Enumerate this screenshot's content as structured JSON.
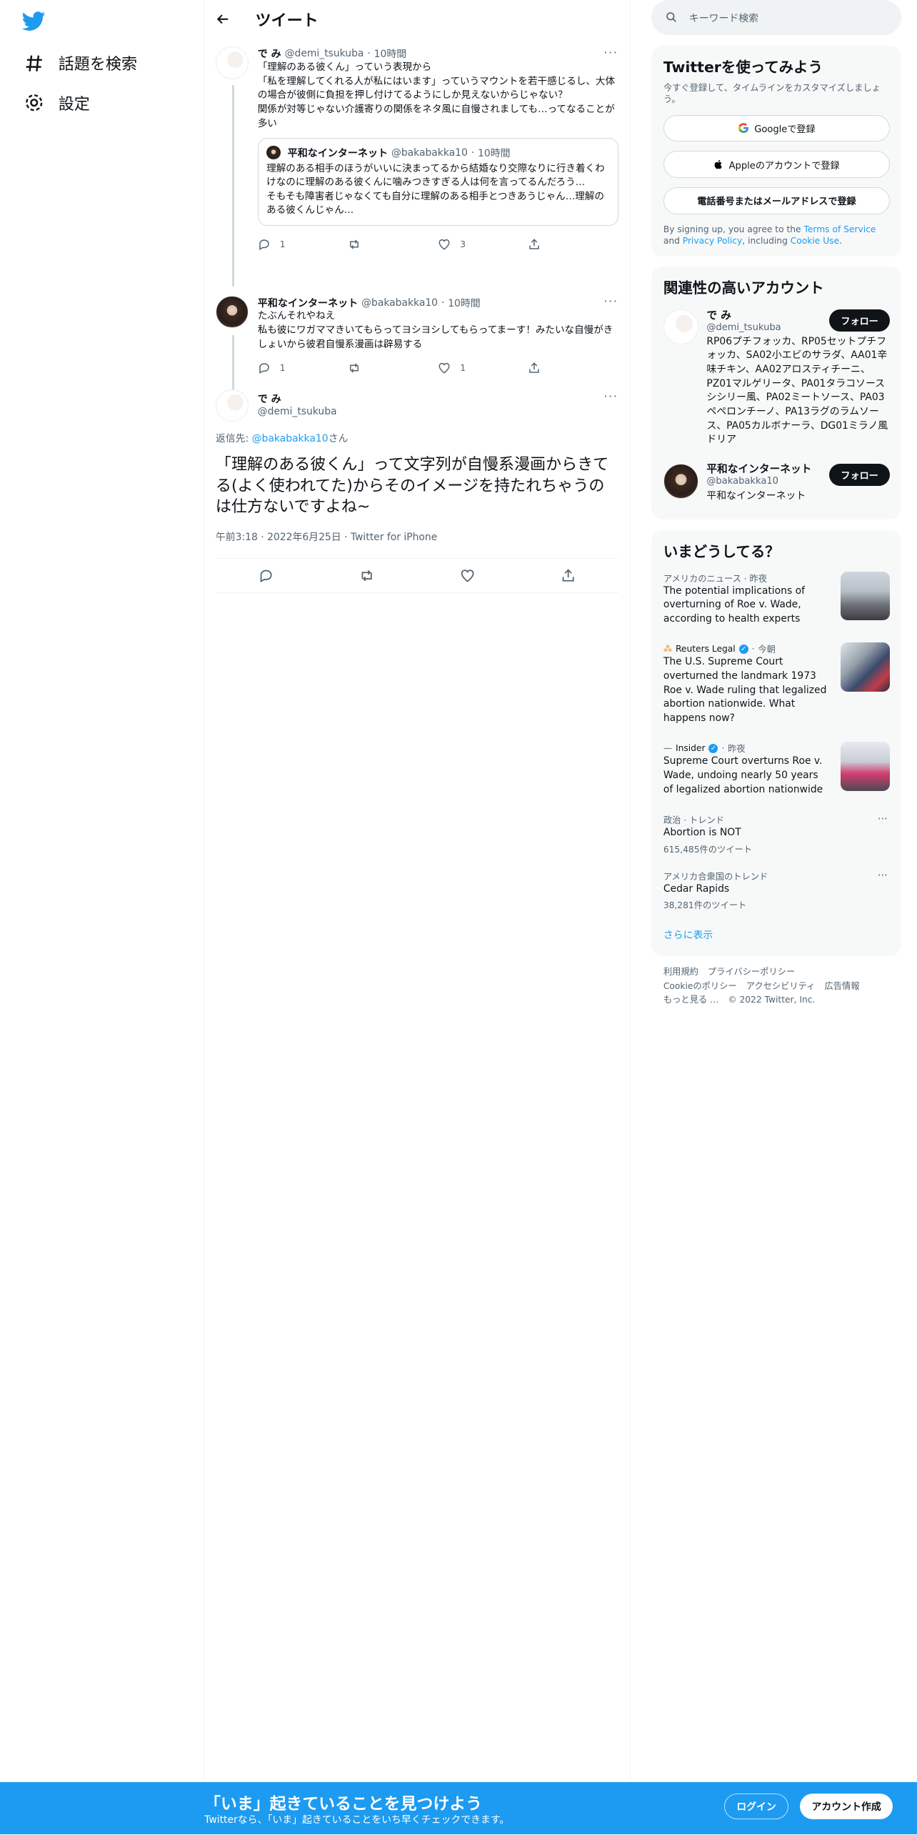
{
  "colors": {
    "accent": "#1d9bf0",
    "text": "#0f1419",
    "muted": "#536471"
  },
  "nav": {
    "explore": "話題を検索",
    "settings": "設定"
  },
  "header": {
    "title": "ツイート"
  },
  "tweet1": {
    "name": "で み",
    "handle": "@demi_tsukuba",
    "time": "10時間",
    "lines": [
      "「理解のある彼くん」っていう表現から",
      "「私を理解してくれる人が私にはいます」っていうマウントを若干感じるし、大体の場合が彼側に負担を押し付けてるようにしか見えないからじゃない？",
      "関係が対等じゃない介護寄りの関係をネタ風に自慢されましても…ってなることが多い"
    ],
    "quote": {
      "name": "平和なインターネット",
      "handle": "@bakabakka10",
      "time": "10時間",
      "lines": [
        "理解のある相手のほうがいいに決まってるから結婚なり交際なりに行き着くわけなのに理解のある彼くんに噛みつきすぎる人は何を言ってるんだろう…",
        "そもそも障害者じゃなくても自分に理解のある相手とつきあうじゃん…理解のある彼くんじゃん…"
      ]
    },
    "replies": "1",
    "retweets": "",
    "likes": "3"
  },
  "tweet2": {
    "name": "平和なインターネット",
    "handle": "@bakabakka10",
    "time": "10時間",
    "lines": [
      "たぶんそれやねえ",
      "私も彼にワガママきいてもらってヨシヨシしてもらってまーす！みたいな自慢がきしょいから彼君自慢系漫画は辟易する"
    ],
    "replies": "1",
    "retweets": "",
    "likes": "1"
  },
  "focus": {
    "name": "で み",
    "handle": "@demi_tsukuba",
    "reply_to_prefix": "返信先: ",
    "reply_to_handle": "@bakabakka10",
    "reply_to_suffix": "さん",
    "text": "「理解のある彼くん」って文字列が自慢系漫画からきてる(よく使われてた)からそのイメージを持たれちゃうのは仕方ないですよね~",
    "timestamp": "午前3:18 · 2022年6月25日 · Twitter for iPhone"
  },
  "search": {
    "placeholder": "キーワード検索"
  },
  "signup": {
    "title": "Twitterを使ってみよう",
    "sub": "今すぐ登録して、タイムラインをカスタマイズしましょう。",
    "google": "Googleで登録",
    "apple": "Appleのアカウントで登録",
    "phone": "電話番号またはメールアドレスで登録",
    "legal_1": "By signing up, you agree to the ",
    "tos": "Terms of Service",
    "legal_2": " and ",
    "privacy": "Privacy Policy",
    "legal_3": ", including ",
    "cookie": "Cookie Use",
    "legal_4": "."
  },
  "related": {
    "title": "関連性の高いアカウント",
    "follow": "フォロー",
    "accounts": [
      {
        "name": "で み",
        "handle": "@demi_tsukuba",
        "bio": "RP06プチフォッカ、RP05セットプチフォッカ、SA02小エビのサラダ、AA01辛味チキン、AA02アロスティチーニ、PZ01マルゲリータ、PA01タラコソースシシリー風、PA02ミートソース、PA03ペペロンチーノ、PA13ラグのラムソース、PA05カルボナーラ、DG01ミラノ風ドリア"
      },
      {
        "name": "平和なインターネット",
        "handle": "@bakabakka10",
        "bio": "平和なインターネット"
      }
    ]
  },
  "trends": {
    "title": "いまどうしてる？",
    "show_more": "さらに表示",
    "items": [
      {
        "cat": "アメリカのニュース · 昨夜",
        "title": "The potential implications of overturning of Roe v. Wade, according to health experts"
      },
      {
        "cat_source": "Reuters Legal",
        "cat_time": "今朝",
        "title": "The U.S. Supreme Court overturned the landmark 1973 Roe v. Wade ruling that legalized abortion nationwide. What happens now?"
      },
      {
        "cat_source": "Insider",
        "cat_time": "昨夜",
        "title": "Supreme Court overturns Roe v. Wade, undoing nearly 50 years of legalized abortion nationwide"
      },
      {
        "cat": "政治 · トレンド",
        "title": "Abortion is NOT",
        "count": "615,485件のツイート"
      },
      {
        "cat": "アメリカ合衆国のトレンド",
        "title": "Cedar Rapids",
        "count": "38,281件のツイート"
      }
    ]
  },
  "footer": {
    "terms": "利用規約",
    "privacy": "プライバシーポリシー",
    "cookie": "Cookieのポリシー",
    "access": "アクセシビリティ",
    "ads": "広告情報",
    "more": "もっと見る …",
    "copyright": "© 2022 Twitter, Inc."
  },
  "bottom_bar": {
    "headline": "「いま」起きていることを見つけよう",
    "sub": "Twitterなら、「いま」起きていることをいち早くチェックできます。",
    "login": "ログイン",
    "signup": "アカウント作成"
  }
}
